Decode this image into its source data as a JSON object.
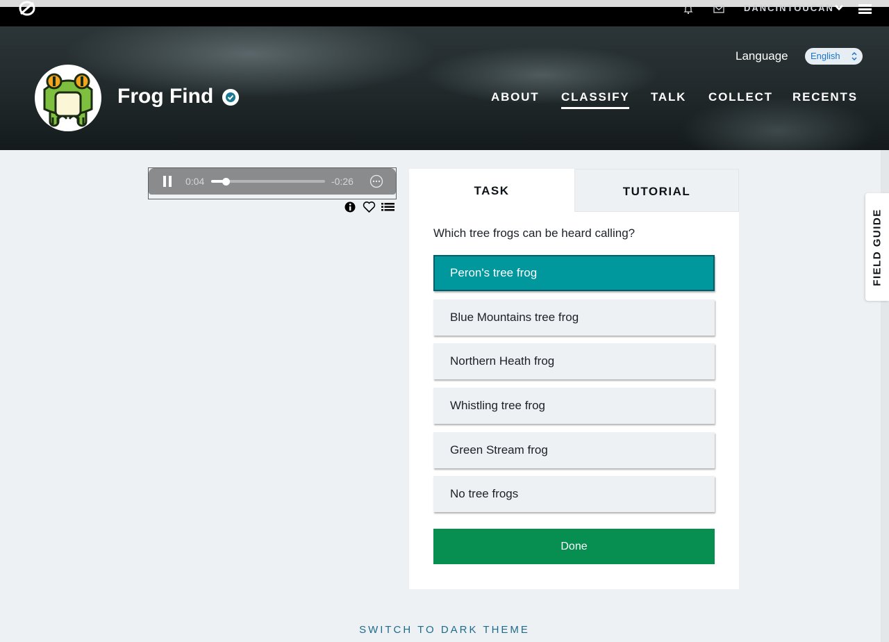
{
  "topbar": {
    "username": "DANCINTOUCAN",
    "icons": [
      "zooniverse-logo-icon",
      "bell-icon",
      "mail-icon",
      "chevron-down-icon",
      "hamburger-menu-icon"
    ]
  },
  "header": {
    "project_title": "Frog Find",
    "language_label": "Language",
    "language_value": "English",
    "nav": [
      {
        "label": "ABOUT",
        "active": false
      },
      {
        "label": "CLASSIFY",
        "active": true
      },
      {
        "label": "TALK",
        "active": false
      },
      {
        "label": "COLLECT",
        "active": false
      },
      {
        "label": "RECENTS",
        "active": false
      }
    ]
  },
  "player": {
    "current_time": "0:04",
    "remaining_time": "-0:26",
    "progress": 0.13
  },
  "subject_icons": [
    "info-icon",
    "heart-icon",
    "list-icon"
  ],
  "task_panel": {
    "tabs": [
      "TASK",
      "TUTORIAL"
    ],
    "question": "Which tree frogs can be heard calling?",
    "answers": [
      {
        "label": "Peron's tree frog",
        "selected": true
      },
      {
        "label": "Blue Mountains tree frog",
        "selected": false
      },
      {
        "label": "Northern Heath frog",
        "selected": false
      },
      {
        "label": "Whistling tree frog",
        "selected": false
      },
      {
        "label": "Green Stream frog",
        "selected": false
      },
      {
        "label": "No tree frogs",
        "selected": false
      }
    ],
    "done_label": "Done"
  },
  "field_guide_label": "FIELD GUIDE",
  "switch_theme_label": "SWITCH TO DARK THEME",
  "colors": {
    "selected_answer": "#00979d",
    "done_button": "#078f52",
    "link": "#1c6b8c"
  }
}
